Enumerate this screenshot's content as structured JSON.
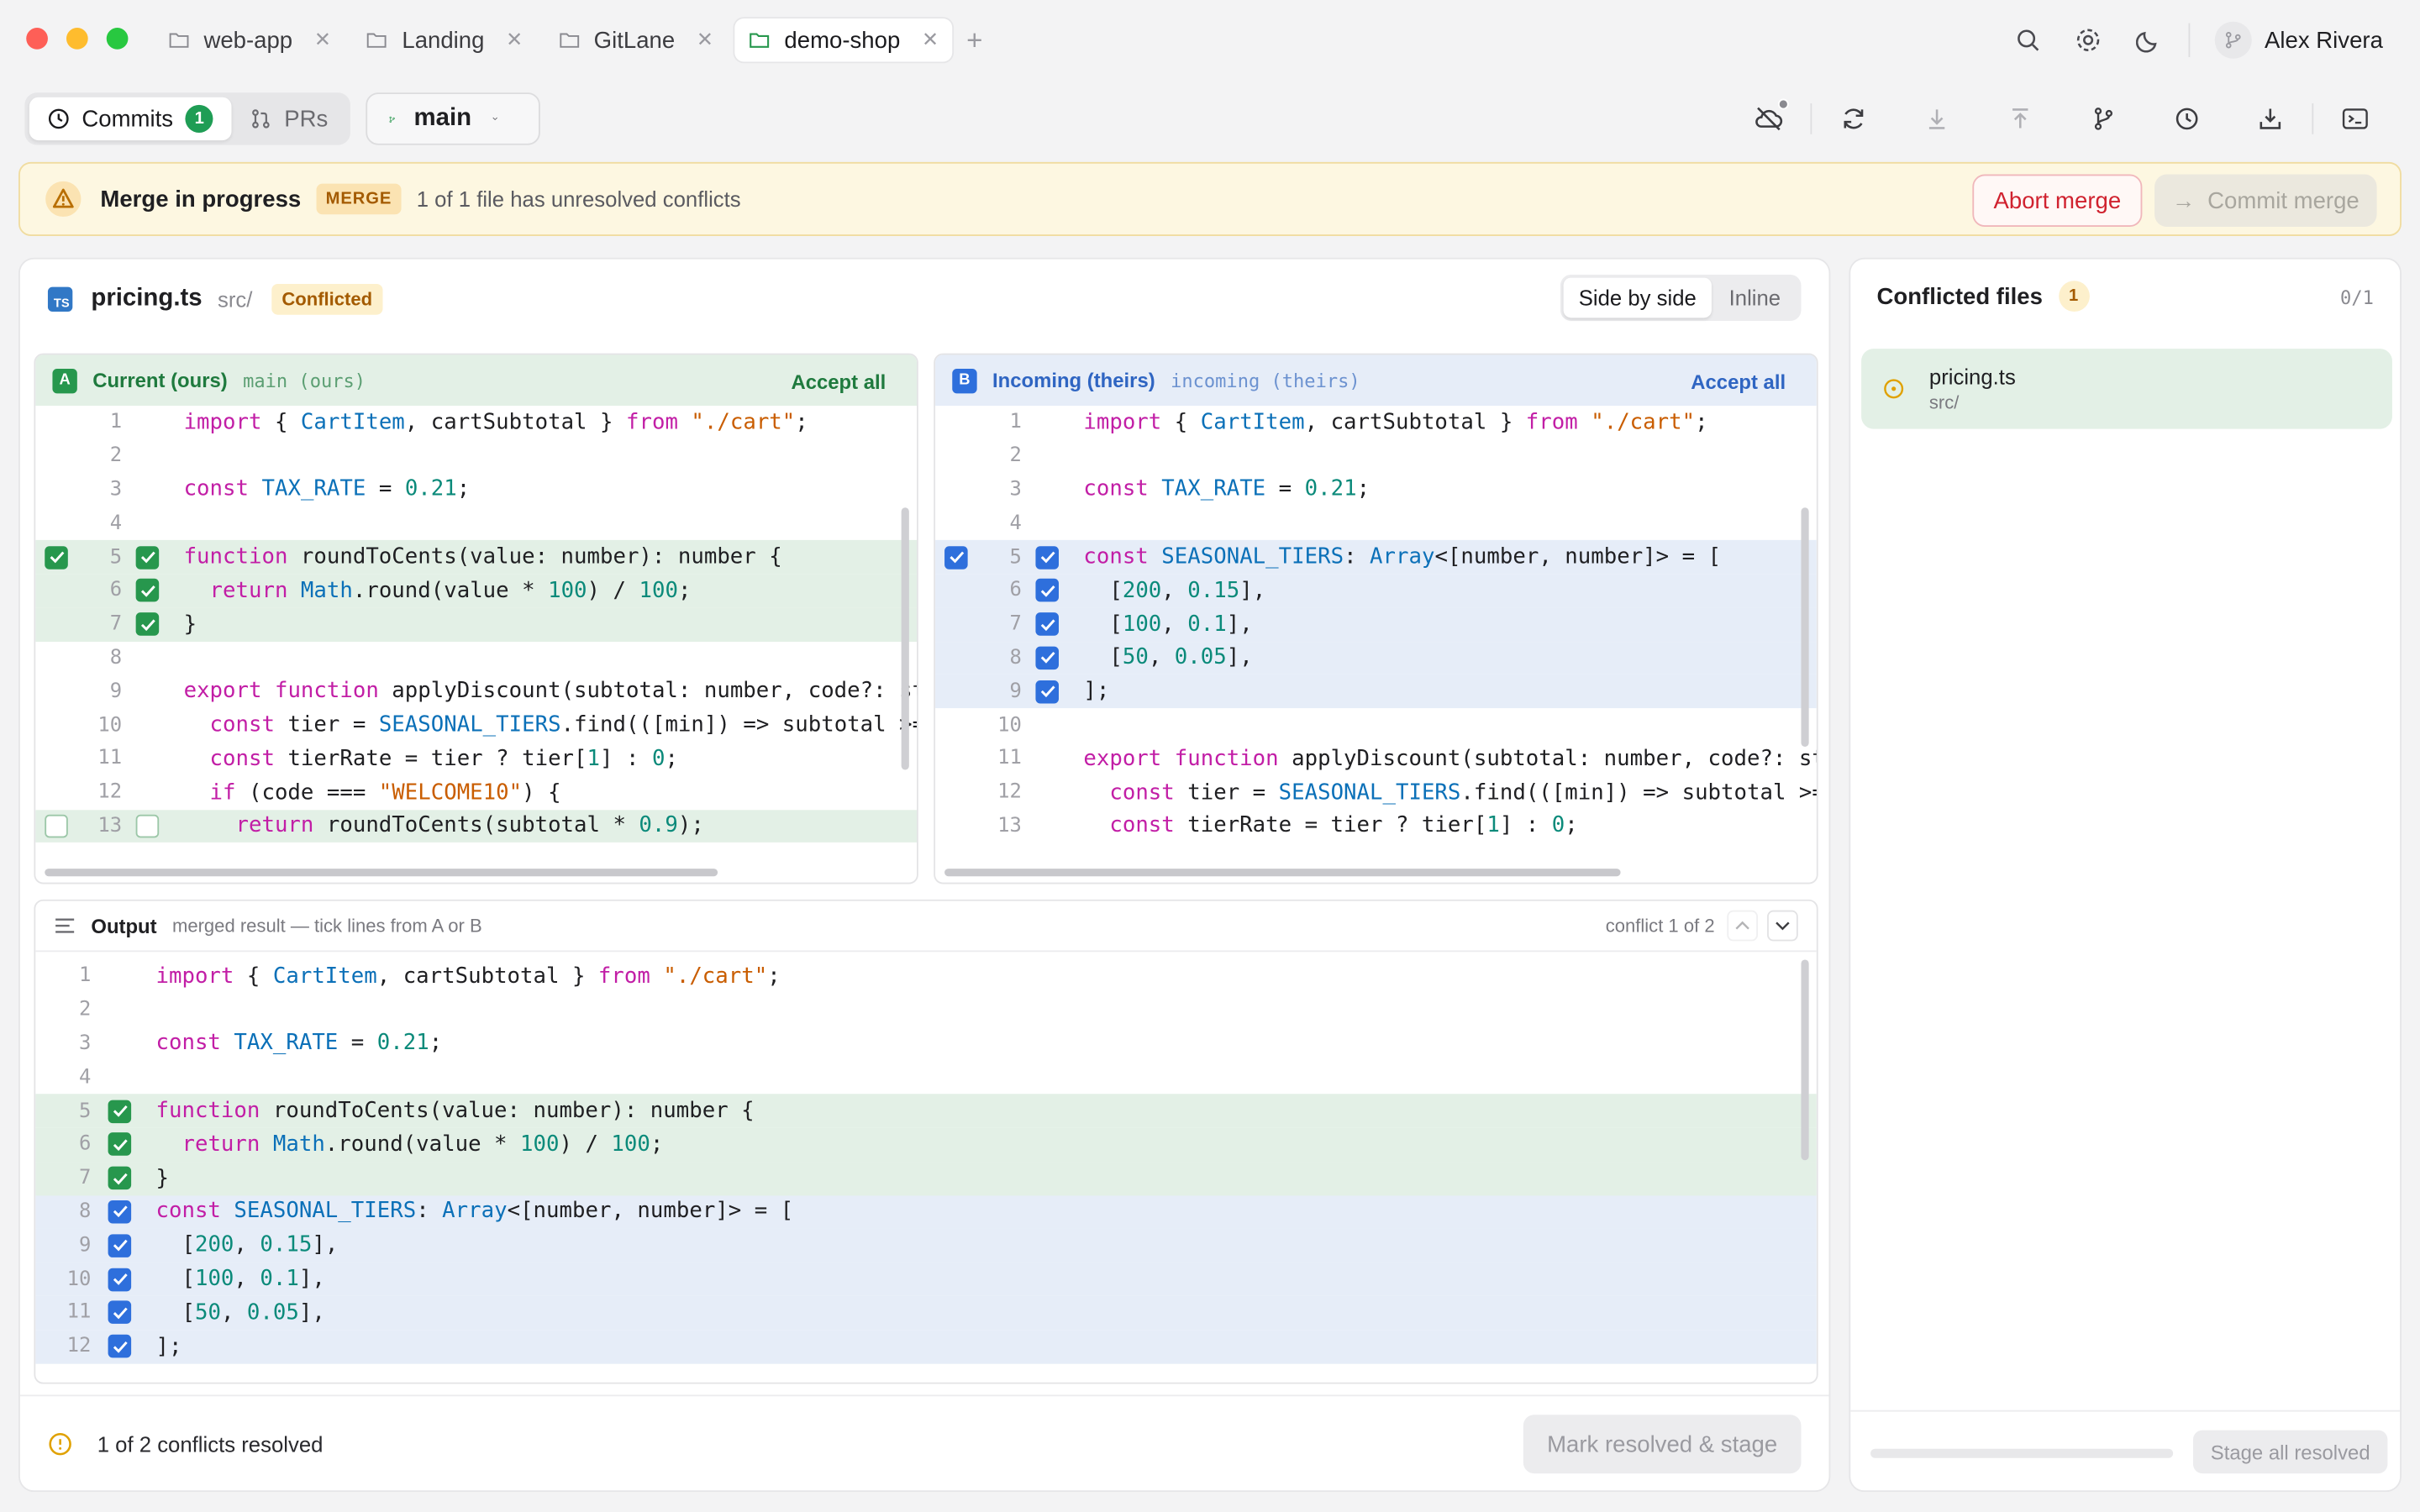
{
  "window": {
    "tabs": [
      {
        "label": "web-app",
        "active": false
      },
      {
        "label": "Landing",
        "active": false
      },
      {
        "label": "GitLane",
        "active": false
      },
      {
        "label": "demo-shop",
        "active": true
      }
    ],
    "user_name": "Alex Rivera"
  },
  "toolbar": {
    "commits_label": "Commits",
    "commits_count": "1",
    "prs_label": "PRs",
    "branch": "main"
  },
  "banner": {
    "title": "Merge in progress",
    "tag": "MERGE",
    "message": "1 of 1 file has unresolved conflicts",
    "abort_label": "Abort merge",
    "commit_label": "Commit merge"
  },
  "file": {
    "icon_label": "TS",
    "name": "pricing.ts",
    "dir": "src/",
    "status": "Conflicted",
    "view_side_by_side": "Side by side",
    "view_inline": "Inline"
  },
  "ours": {
    "letter": "A",
    "title": "Current (ours)",
    "sub": "main (ours)",
    "accept_label": "Accept all",
    "lines": [
      {
        "n": "1",
        "html": "<span class=\"kw\">import</span> { <span class=\"ty\">CartItem</span>, cartSubtotal } <span class=\"kw\">from</span> <span class=\"st\">\"./cart\"</span>;"
      },
      {
        "n": "2",
        "html": ""
      },
      {
        "n": "3",
        "html": "<span class=\"kw\">const</span> <span class=\"ty\">TAX_RATE</span> = <span class=\"nm\">0.21</span>;"
      },
      {
        "n": "4",
        "html": ""
      },
      {
        "n": "5",
        "html": "<span class=\"kw\">function</span> roundToCents(value: number): number {",
        "hl": "g",
        "cb1": "on",
        "cb2": "on"
      },
      {
        "n": "6",
        "html": "  <span class=\"kw\">return</span> <span class=\"ty\">Math</span>.round(value * <span class=\"nm\">100</span>) / <span class=\"nm\">100</span>;",
        "hl": "g",
        "cb2": "on"
      },
      {
        "n": "7",
        "html": "}",
        "hl": "g",
        "cb2": "on"
      },
      {
        "n": "8",
        "html": ""
      },
      {
        "n": "9",
        "html": "<span class=\"kw\">export</span> <span class=\"kw\">function</span> applyDiscount(subtotal: number, code?: str"
      },
      {
        "n": "10",
        "html": "  <span class=\"kw\">const</span> tier = <span class=\"ty\">SEASONAL_TIERS</span>.find(([min]) => subtotal >="
      },
      {
        "n": "11",
        "html": "  <span class=\"kw\">const</span> tierRate = tier ? tier[<span class=\"nm\">1</span>] : <span class=\"nm\">0</span>;"
      },
      {
        "n": "12",
        "html": "  <span class=\"kw\">if</span> (code === <span class=\"st\">\"WELCOME10\"</span>) {"
      },
      {
        "n": "13",
        "html": "    <span class=\"kw\">return</span> roundToCents(subtotal * <span class=\"nm\">0.9</span>);",
        "hl": "g",
        "cb1": "off",
        "cb2": "off"
      }
    ]
  },
  "theirs": {
    "letter": "B",
    "title": "Incoming (theirs)",
    "sub": "incoming (theirs)",
    "accept_label": "Accept all",
    "lines": [
      {
        "n": "1",
        "html": "<span class=\"kw\">import</span> { <span class=\"ty\">CartItem</span>, cartSubtotal } <span class=\"kw\">from</span> <span class=\"st\">\"./cart\"</span>;"
      },
      {
        "n": "2",
        "html": ""
      },
      {
        "n": "3",
        "html": "<span class=\"kw\">const</span> <span class=\"ty\">TAX_RATE</span> = <span class=\"nm\">0.21</span>;"
      },
      {
        "n": "4",
        "html": ""
      },
      {
        "n": "5",
        "html": "<span class=\"kw\">const</span> <span class=\"ty\">SEASONAL_TIERS</span>: <span class=\"ty\">Array</span>&lt;[number, number]&gt; = [",
        "hl": "b",
        "cb1": "on",
        "cb2": "on"
      },
      {
        "n": "6",
        "html": "  [<span class=\"nm\">200</span>, <span class=\"nm\">0.15</span>],",
        "hl": "b",
        "cb2": "on"
      },
      {
        "n": "7",
        "html": "  [<span class=\"nm\">100</span>, <span class=\"nm\">0.1</span>],",
        "hl": "b",
        "cb2": "on"
      },
      {
        "n": "8",
        "html": "  [<span class=\"nm\">50</span>, <span class=\"nm\">0.05</span>],",
        "hl": "b",
        "cb2": "on"
      },
      {
        "n": "9",
        "html": "];",
        "hl": "b",
        "cb2": "on"
      },
      {
        "n": "10",
        "html": ""
      },
      {
        "n": "11",
        "html": "<span class=\"kw\">export</span> <span class=\"kw\">function</span> applyDiscount(subtotal: number, code?: str"
      },
      {
        "n": "12",
        "html": "  <span class=\"kw\">const</span> tier = <span class=\"ty\">SEASONAL_TIERS</span>.find(([min]) => subtotal >="
      },
      {
        "n": "13",
        "html": "  <span class=\"kw\">const</span> tierRate = tier ? tier[<span class=\"nm\">1</span>] : <span class=\"nm\">0</span>;"
      }
    ]
  },
  "output": {
    "title": "Output",
    "sub": "merged result — tick lines from A or B",
    "nav_label": "conflict 1 of 2",
    "lines": [
      {
        "n": "1",
        "html": "<span class=\"kw\">import</span> { <span class=\"ty\">CartItem</span>, cartSubtotal } <span class=\"kw\">from</span> <span class=\"st\">\"./cart\"</span>;"
      },
      {
        "n": "2",
        "html": ""
      },
      {
        "n": "3",
        "html": "<span class=\"kw\">const</span> <span class=\"ty\">TAX_RATE</span> = <span class=\"nm\">0.21</span>;"
      },
      {
        "n": "4",
        "html": ""
      },
      {
        "n": "5",
        "html": "<span class=\"kw\">function</span> roundToCents(value: number): number {",
        "hl": "g",
        "cb2": "on"
      },
      {
        "n": "6",
        "html": "  <span class=\"kw\">return</span> <span class=\"ty\">Math</span>.round(value * <span class=\"nm\">100</span>) / <span class=\"nm\">100</span>;",
        "hl": "g",
        "cb2": "on"
      },
      {
        "n": "7",
        "html": "}",
        "hl": "g",
        "cb2": "on"
      },
      {
        "n": "8",
        "html": "<span class=\"kw\">const</span> <span class=\"ty\">SEASONAL_TIERS</span>: <span class=\"ty\">Array</span>&lt;[number, number]&gt; = [",
        "hl": "b",
        "cb2": "on"
      },
      {
        "n": "9",
        "html": "  [<span class=\"nm\">200</span>, <span class=\"nm\">0.15</span>],",
        "hl": "b",
        "cb2": "on"
      },
      {
        "n": "10",
        "html": "  [<span class=\"nm\">100</span>, <span class=\"nm\">0.1</span>],",
        "hl": "b",
        "cb2": "on"
      },
      {
        "n": "11",
        "html": "  [<span class=\"nm\">50</span>, <span class=\"nm\">0.05</span>],",
        "hl": "b",
        "cb2": "on"
      },
      {
        "n": "12",
        "html": "];",
        "hl": "b",
        "cb2": "on"
      }
    ]
  },
  "footer": {
    "resolved_text": "1 of 2 conflicts resolved",
    "stage_label": "Mark resolved & stage"
  },
  "side": {
    "title": "Conflicted files",
    "badge": "1",
    "count": "0/1",
    "files": [
      {
        "name": "pricing.ts",
        "dir": "src/"
      }
    ],
    "progress": 0,
    "stage_all_label": "Stage all resolved"
  },
  "colors": {
    "ours_accent": "#27974d",
    "theirs_accent": "#2e6fdc",
    "warning": "#e0a100",
    "danger": "#d0222f"
  }
}
